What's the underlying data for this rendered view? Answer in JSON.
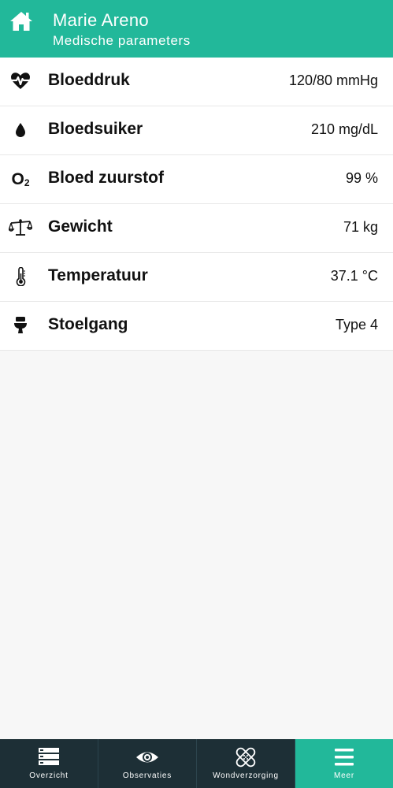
{
  "header": {
    "title": "Marie Areno",
    "subtitle": "Medische parameters"
  },
  "parameters": [
    {
      "icon": "heartbeat-icon",
      "label": "Bloeddruk",
      "value": "120/80 mmHg"
    },
    {
      "icon": "drop-icon",
      "label": "Bloedsuiker",
      "value": "210 mg/dL"
    },
    {
      "icon": "oxygen-icon",
      "label": "Bloed zuurstof",
      "value": "99 %",
      "icon_text": "O",
      "icon_sub": "2"
    },
    {
      "icon": "scale-icon",
      "label": "Gewicht",
      "value": "71 kg"
    },
    {
      "icon": "thermometer-icon",
      "label": "Temperatuur",
      "value": "37.1 °C"
    },
    {
      "icon": "toilet-icon",
      "label": "Stoelgang",
      "value": "Type 4"
    }
  ],
  "bottom_nav": [
    {
      "icon": "list-icon",
      "label": "Overzicht",
      "active": false
    },
    {
      "icon": "eye-icon",
      "label": "Observaties",
      "active": false
    },
    {
      "icon": "bandage-icon",
      "label": "Wondverzorging",
      "active": false
    },
    {
      "icon": "menu-icon",
      "label": "Meer",
      "active": true
    }
  ],
  "colors": {
    "accent": "#22b89a",
    "nav_background": "#1d2f36"
  }
}
